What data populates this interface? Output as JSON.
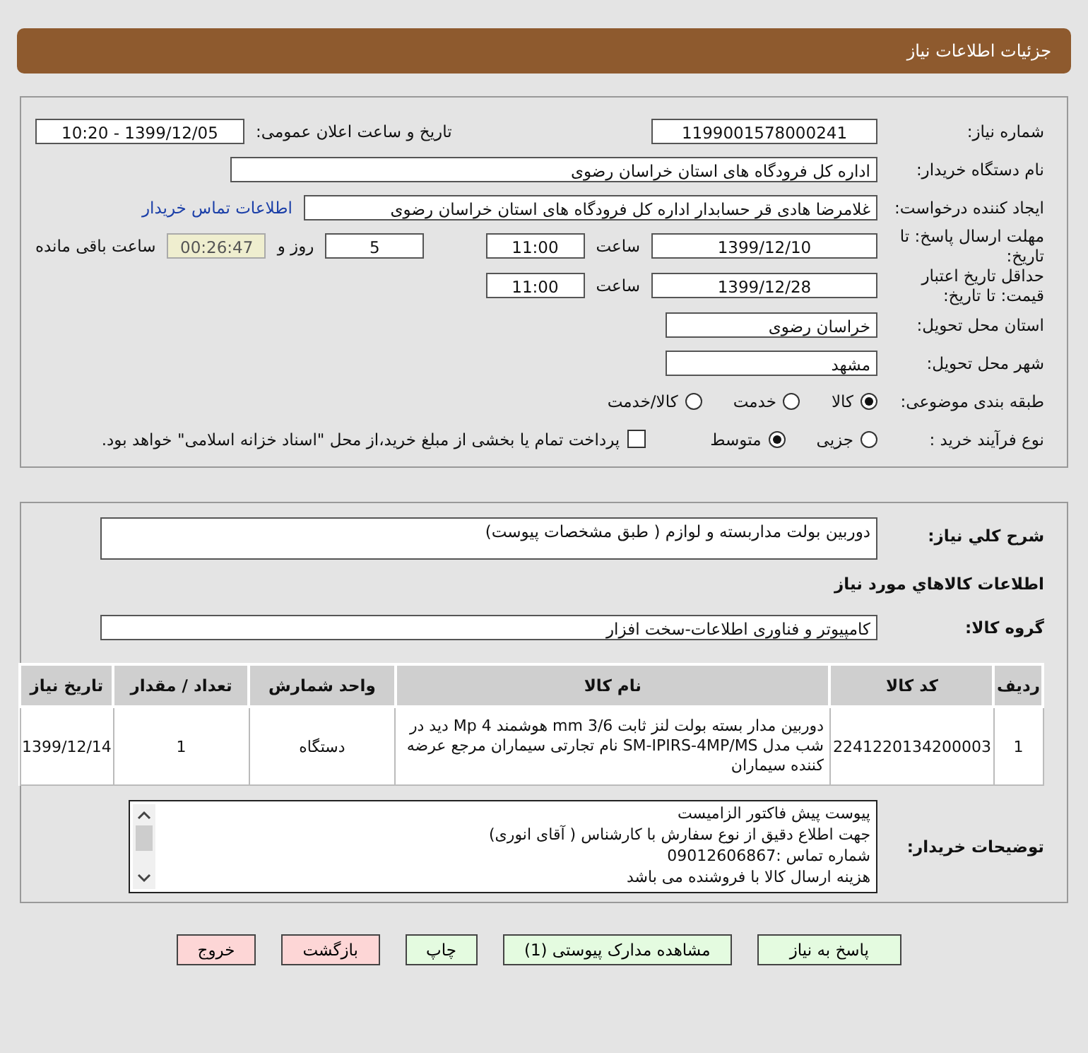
{
  "header": {
    "title": "جزئیات اطلاعات نیاز"
  },
  "info": {
    "need_number": {
      "label": "شماره نیاز:",
      "value": "1199001578000241"
    },
    "announce": {
      "label": "تاریخ و ساعت اعلان عمومی:",
      "value": "1399/12/05 - 10:20"
    },
    "buyer_org": {
      "label": "نام دستگاه خریدار:",
      "value": "اداره کل فرودگاه های استان خراسان رضوی"
    },
    "requester": {
      "label": "ایجاد کننده درخواست:",
      "value": "غلامرضا هادی قر حسابدار اداره کل فرودگاه های استان خراسان رضوی",
      "link": "اطلاعات تماس خریدار"
    },
    "response_deadline": {
      "label": "مهلت ارسال پاسخ: تا تاریخ:",
      "date": "1399/12/10",
      "time_label": "ساعت",
      "time": "11:00",
      "days": "5",
      "days_label": "روز و",
      "remaining": "00:26:47",
      "remaining_label": "ساعت باقی مانده"
    },
    "price_validity": {
      "label": "حداقل تاریخ اعتبار قیمت: تا تاریخ:",
      "date": "1399/12/28",
      "time_label": "ساعت",
      "time": "11:00"
    },
    "province": {
      "label": "استان محل تحویل:",
      "value": "خراسان رضوی"
    },
    "city": {
      "label": "شهر محل تحویل:",
      "value": "مشهد"
    },
    "category": {
      "label": "طبقه بندی موضوعی:",
      "options": [
        {
          "label": "کالا",
          "selected": true
        },
        {
          "label": "خدمت",
          "selected": false
        },
        {
          "label": "کالا/خدمت",
          "selected": false
        }
      ]
    },
    "purchase_process": {
      "label": "نوع فرآیند خرید :",
      "options": [
        {
          "label": "جزیی",
          "selected": false
        },
        {
          "label": "متوسط",
          "selected": true
        }
      ],
      "payment": {
        "label": "پرداخت تمام یا بخشی از مبلغ خرید،از محل \"اسناد خزانه اسلامی\" خواهد بود.",
        "checked": false
      }
    }
  },
  "description": {
    "label": "شرح کلي نياز:",
    "value": "دوربین بولت  مداربسته و لوازم ( طبق مشخصات پیوست)"
  },
  "goods_heading": "اطلاعات کالاهاي مورد نياز",
  "goods_group": {
    "label": "گروه کالا:",
    "value": "کامپیوتر و فناوری اطلاعات-سخت افزار"
  },
  "table": {
    "columns": [
      "ردیف",
      "کد کالا",
      "نام کالا",
      "واحد شمارش",
      "تعداد / مقدار",
      "تاریخ نیاز"
    ],
    "rows": [
      [
        "1",
        "2241220134200003",
        "دوربین مدار بسته بولت لنز ثابت mm 3/6 هوشمند Mp 4 دید در شب مدل SM-IPIRS-4MP/MS نام تجارتی سیماران مرجع عرضه کننده سیماران",
        "دستگاه",
        "1",
        "1399/12/14"
      ]
    ]
  },
  "buyer_notes": {
    "label": "توضیحات خریدار:",
    "lines": [
      "پیوست پیش فاکتور الزامیست",
      "جهت اطلاع دقیق از نوع سفارش با کارشناس   ( آقای انوری)",
      "شماره تماس :09012606867",
      "هزینه ارسال کالا با فروشنده می باشد"
    ]
  },
  "buttons": [
    {
      "label": "پاسخ به نیاز",
      "kind": "green"
    },
    {
      "label": "مشاهده مدارک پیوستی (1)",
      "kind": "green"
    },
    {
      "label": "چاپ",
      "kind": "green"
    },
    {
      "label": "بازگشت",
      "kind": "red"
    },
    {
      "label": "خروج",
      "kind": "red"
    }
  ]
}
